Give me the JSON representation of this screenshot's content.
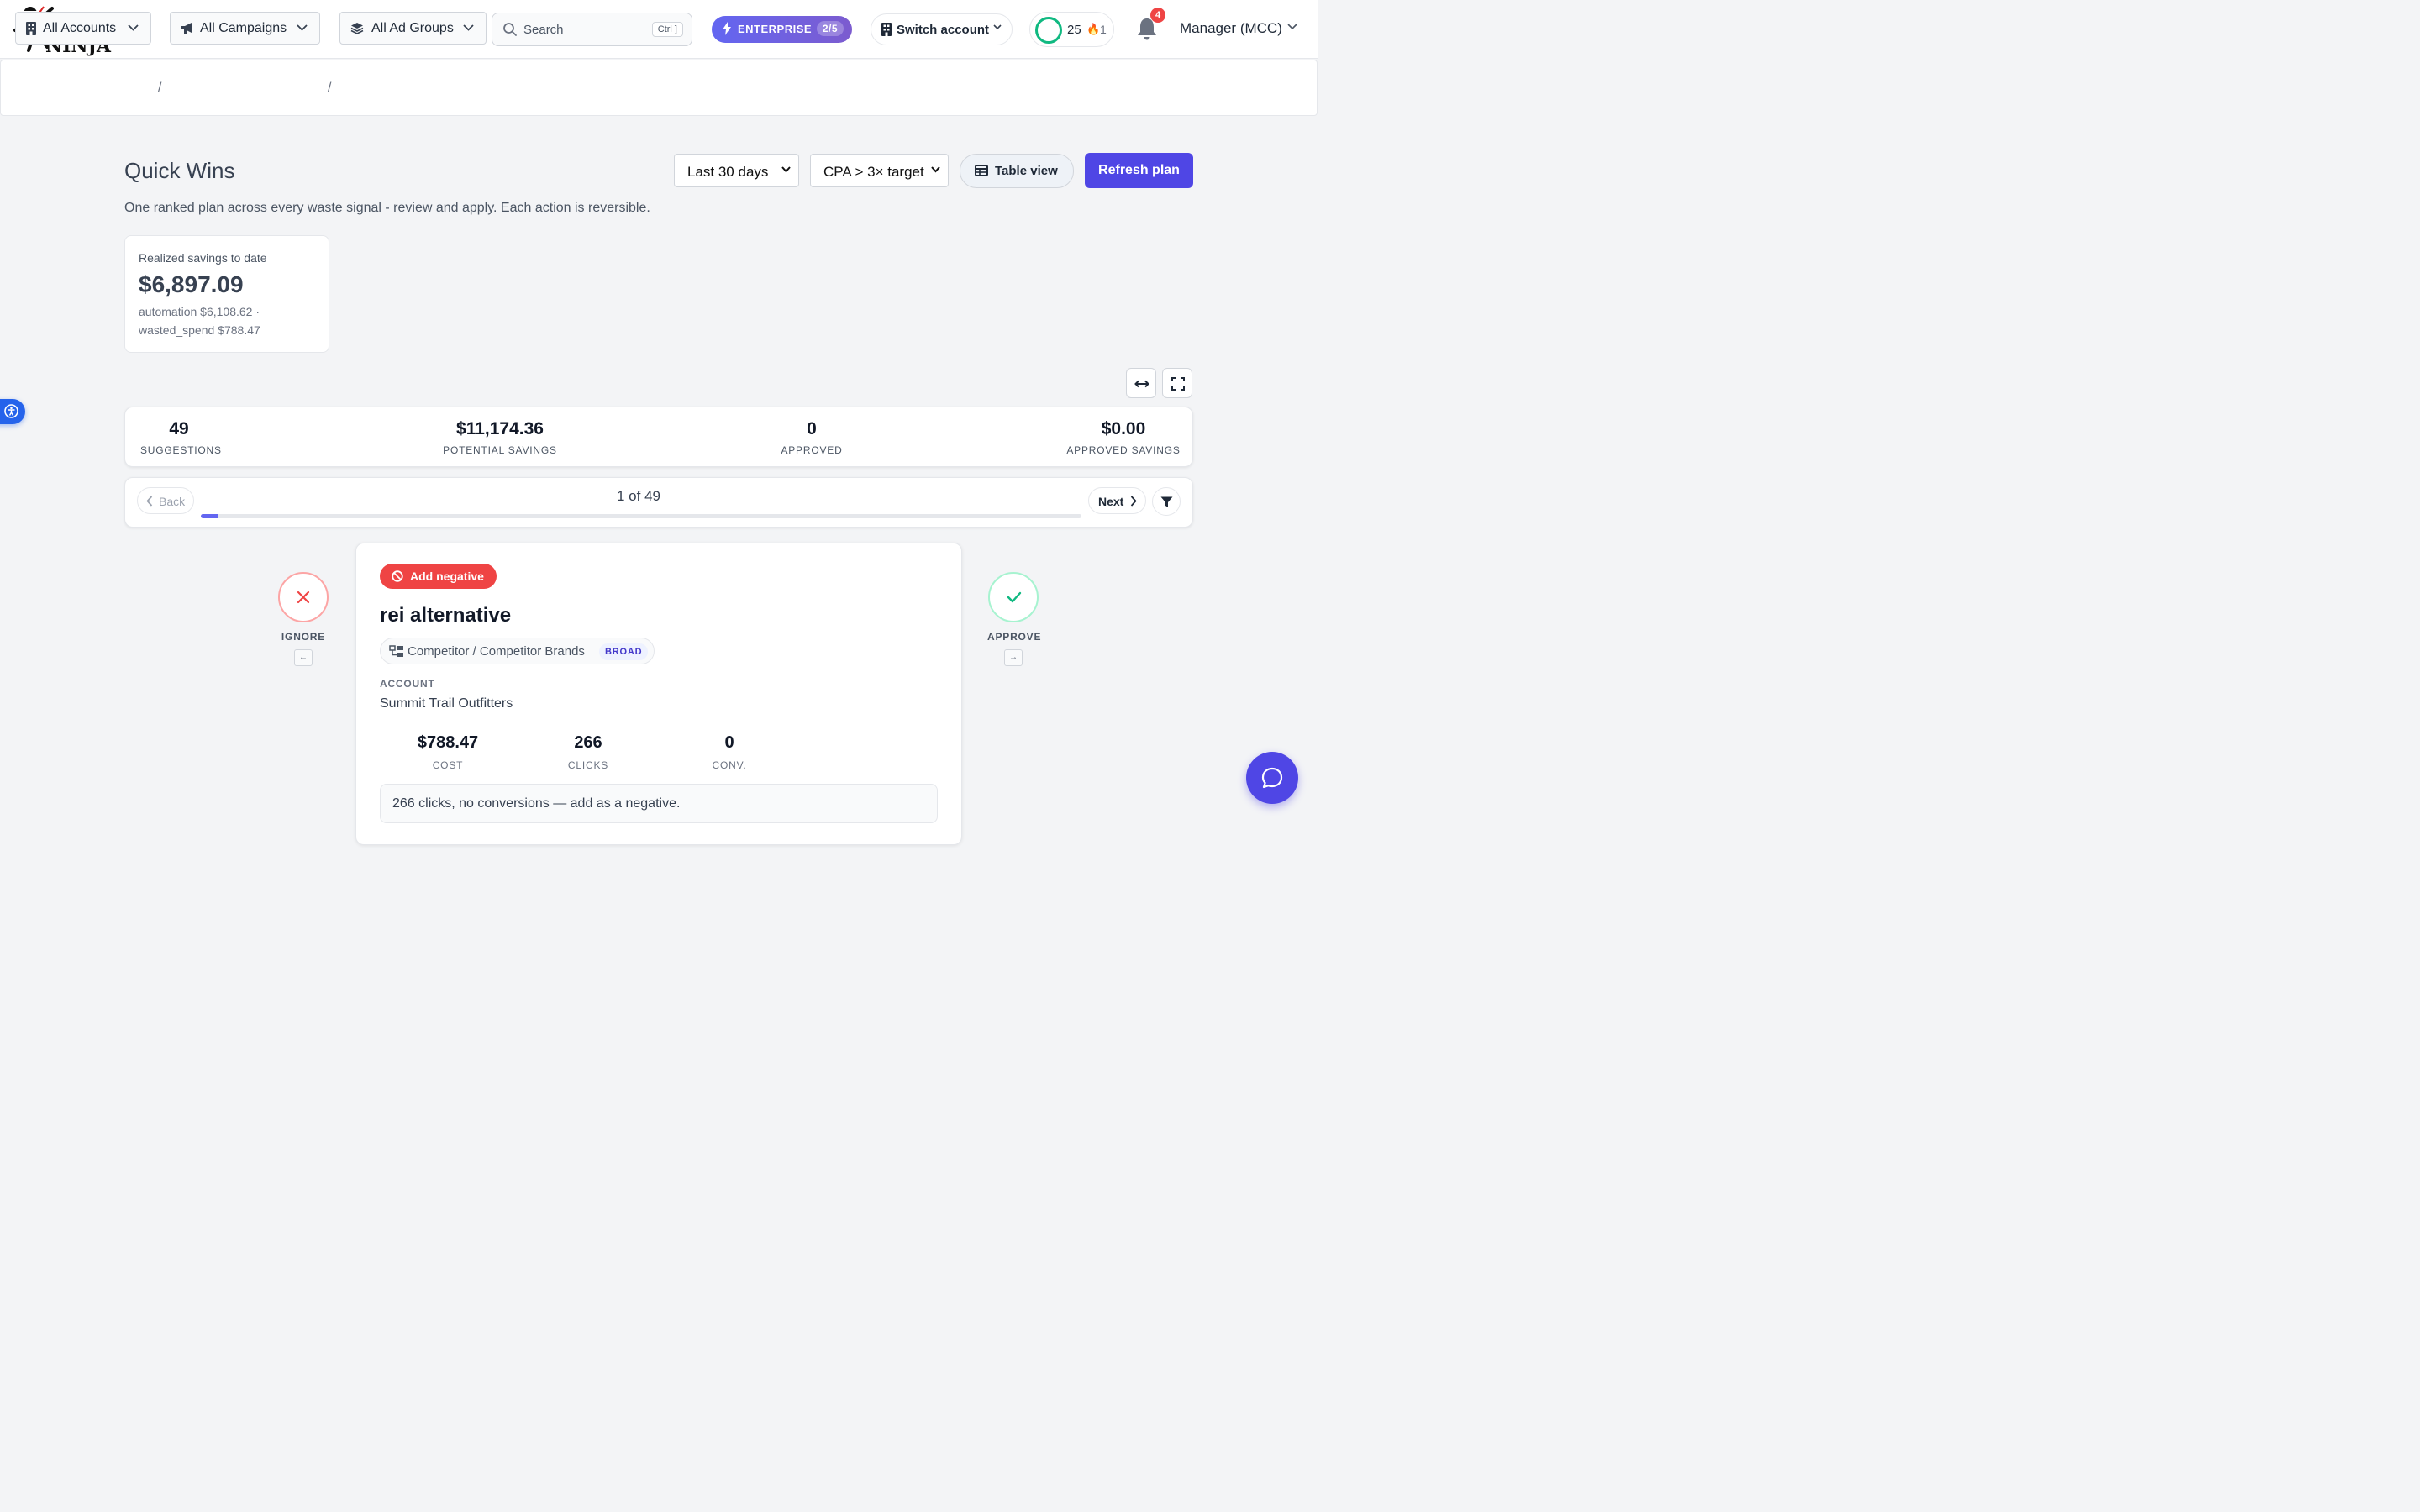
{
  "brand": {
    "word_part1": "K",
    "word_part2": "eyword",
    "ninja": "NINJA"
  },
  "search": {
    "placeholder": "Search",
    "shortcut": "Ctrl ]"
  },
  "plan_badge": {
    "label": "ENTERPRISE",
    "count": "2/5"
  },
  "switch_account": {
    "label": "Switch account"
  },
  "points": {
    "score": "25",
    "streak": "1"
  },
  "notifications": {
    "count": "4"
  },
  "user_menu": {
    "label": "Manager (MCC)"
  },
  "breadcrumb": {
    "accounts": "All Accounts",
    "campaigns": "All Campaigns",
    "ad_groups": "All Ad Groups",
    "separator": "/"
  },
  "page": {
    "title": "Quick Wins",
    "subtitle": "One ranked plan across every waste signal - review and apply. Each action is reversible."
  },
  "filters": {
    "date_range": "Last 30 days",
    "rule": "CPA > 3× target",
    "table_view": "Table view",
    "refresh": "Refresh plan"
  },
  "realized": {
    "label": "Realized savings to date",
    "value": "$6,897.09",
    "line1": "automation $6,108.62 ·",
    "line2": "wasted_spend $788.47"
  },
  "summary": {
    "suggestions": {
      "value": "49",
      "label": "SUGGESTIONS"
    },
    "potential": {
      "value": "$11,174.36",
      "label": "POTENTIAL SAVINGS"
    },
    "approved": {
      "value": "0",
      "label": "APPROVED"
    },
    "approved_savings": {
      "value": "$0.00",
      "label": "APPROVED SAVINGS"
    }
  },
  "pager": {
    "back": "Back",
    "position": "1 of 49",
    "next": "Next",
    "progress": 0.0204
  },
  "actions": {
    "ignore": {
      "label": "IGNORE",
      "key": "←"
    },
    "approve": {
      "label": "APPROVE",
      "key": "→"
    }
  },
  "suggestion": {
    "action_tag": "Add negative",
    "keyword": "rei alternative",
    "path": "Competitor / Competitor Brands",
    "match_type": "BROAD",
    "account_label": "ACCOUNT",
    "account_value": "Summit Trail Outfitters",
    "metrics": [
      {
        "value": "$788.47",
        "label": "COST"
      },
      {
        "value": "266",
        "label": "CLICKS"
      },
      {
        "value": "0",
        "label": "CONV."
      }
    ],
    "reason": "266 clicks, no conversions — add as a negative."
  },
  "colors": {
    "primary": "#4f46e5",
    "danger": "#ef4444",
    "success": "#10b981",
    "link": "#3b82f6"
  }
}
